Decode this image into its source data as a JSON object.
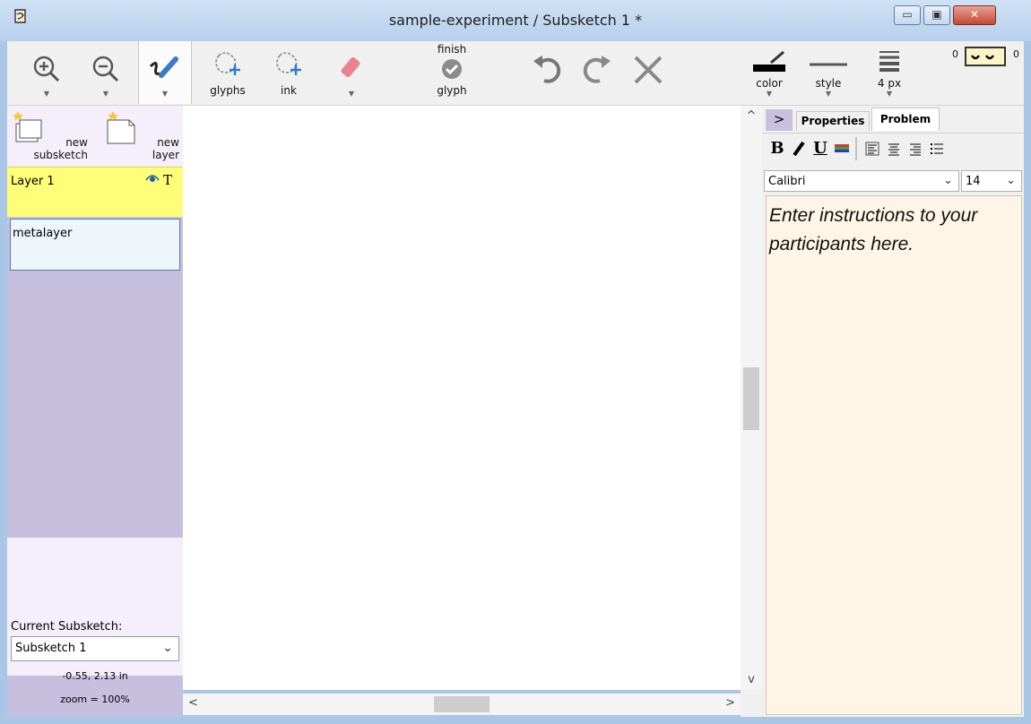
{
  "window": {
    "title": "sample-experiment / Subsketch 1 *",
    "app_icon": "application-icon",
    "min_label": "▭",
    "max_label": "▣",
    "close_label": "✕"
  },
  "toolbar": {
    "zoom_in_icon": "zoom-in-icon",
    "zoom_out_icon": "zoom-out-icon",
    "pen_icon": "pen-icon",
    "glyphs_label": "glyphs",
    "ink_label": "ink",
    "eraser_icon": "eraser-icon",
    "finish_top": "finish",
    "finish_bottom": "glyph",
    "color_label": "color",
    "style_label": "style",
    "width_label": "4 px",
    "zoom_left": "0",
    "zoom_right": "0"
  },
  "left_panel": {
    "new_subsketch_line1": "new",
    "new_subsketch_line2": "subsketch",
    "new_layer_line1": "new",
    "new_layer_line2": "layer",
    "layers": [
      {
        "name": "Layer 1"
      },
      {
        "name": "metalayer"
      }
    ],
    "visible_icon": "eye-icon",
    "text_icon_label": "T",
    "current_subsketch_label": "Current Subsketch:",
    "current_subsketch_value": "Subsketch 1",
    "coords": "-0.55, 2.13 in",
    "zoom": "zoom = 100%"
  },
  "right_panel": {
    "collapse_label": ">",
    "tabs": [
      {
        "label": "Properties"
      },
      {
        "label": "Problem"
      }
    ],
    "font_name": "Calibri",
    "font_size": "14",
    "editor_text": "Enter instructions to your participants here."
  },
  "scroll": {
    "up": "^",
    "down": "v",
    "left": "<",
    "right": ">"
  }
}
